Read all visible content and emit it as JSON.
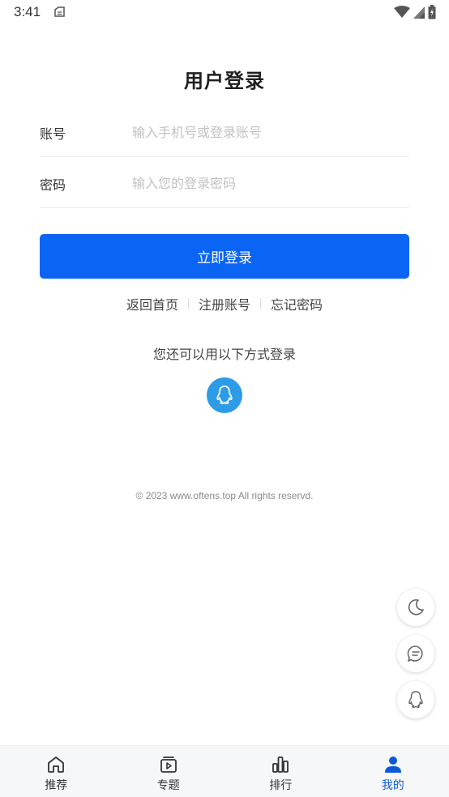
{
  "status_bar": {
    "time": "3:41"
  },
  "title": "用户登录",
  "form": {
    "account_label": "账号",
    "account_placeholder": "输入手机号或登录账号",
    "password_label": "密码",
    "password_placeholder": "输入您的登录密码"
  },
  "login_button": "立即登录",
  "links": [
    {
      "label": "返回首页"
    },
    {
      "label": "注册账号"
    },
    {
      "label": "忘记密码"
    }
  ],
  "alt_login_text": "您还可以用以下方式登录",
  "copyright": "© 2023 www.oftens.top All rights reservd.",
  "colors": {
    "primary": "#0a65f5",
    "qq": "#2d9be8",
    "active_nav": "#0a5ad8"
  },
  "floating_buttons": [
    {
      "icon": "moon-icon"
    },
    {
      "icon": "chat-icon"
    },
    {
      "icon": "qq-icon"
    }
  ],
  "bottom_nav": [
    {
      "label": "推荐",
      "icon": "home-icon",
      "active": false
    },
    {
      "label": "专题",
      "icon": "video-icon",
      "active": false
    },
    {
      "label": "排行",
      "icon": "rank-icon",
      "active": false
    },
    {
      "label": "我的",
      "icon": "user-icon",
      "active": true
    }
  ]
}
